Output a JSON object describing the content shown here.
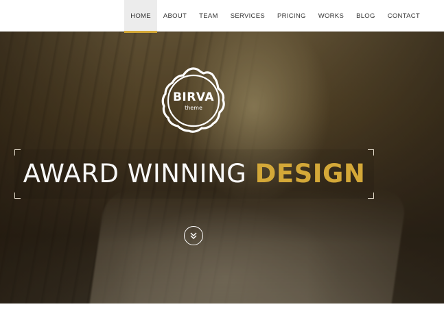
{
  "nav": {
    "items": [
      {
        "label": "HOME",
        "active": true
      },
      {
        "label": "ABOUT",
        "active": false
      },
      {
        "label": "TEAM",
        "active": false
      },
      {
        "label": "SERVICES",
        "active": false
      },
      {
        "label": "PRICING",
        "active": false
      },
      {
        "label": "WORKS",
        "active": false
      },
      {
        "label": "BLOG",
        "active": false
      },
      {
        "label": "CONTACT",
        "active": false
      }
    ]
  },
  "logo": {
    "name": "BIRVA",
    "subtitle": "theme"
  },
  "hero": {
    "tagline_part1": "AWARD WINNING",
    "tagline_part2": "DESIGN",
    "scroll_icon": "double-chevron-down-icon"
  },
  "colors": {
    "accent": "#d4a838",
    "nav_active_bg": "#ececec",
    "nav_text": "#333333"
  }
}
